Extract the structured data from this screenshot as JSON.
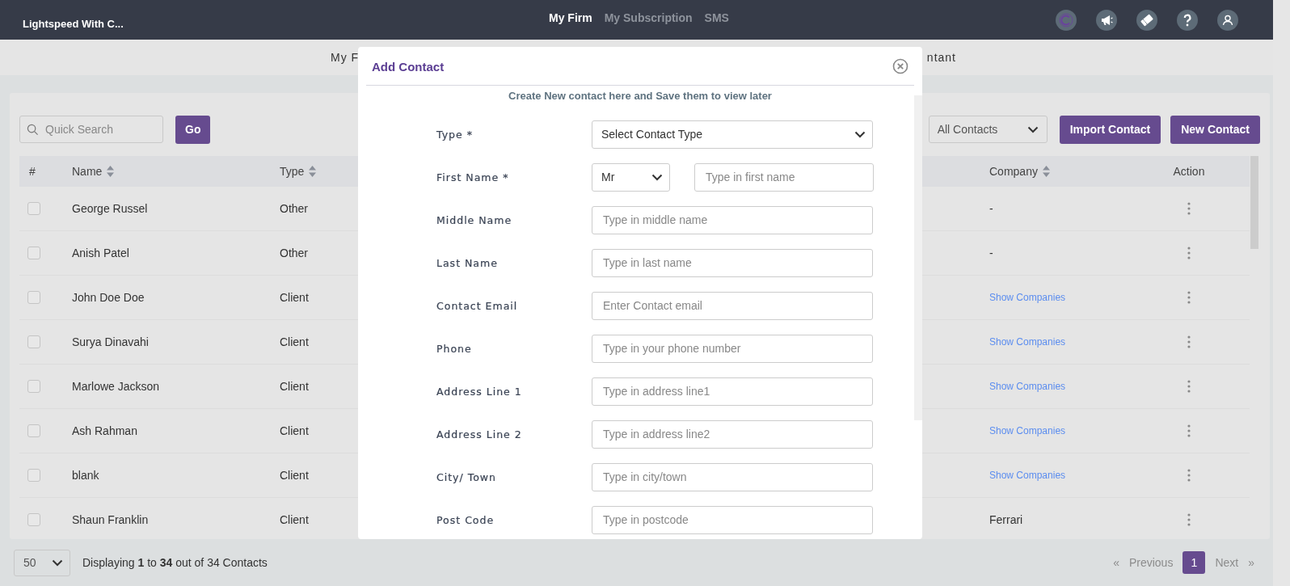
{
  "topbar": {
    "brand": "Lightspeed With C...",
    "nav": [
      {
        "label": "My Firm",
        "selected": true
      },
      {
        "label": "My Subscription",
        "selected": false
      },
      {
        "label": "SMS",
        "selected": false
      }
    ]
  },
  "subnav": {
    "items": [
      {
        "label": "My F"
      },
      {
        "label": "ntant"
      }
    ]
  },
  "toolbar": {
    "search": {
      "placeholder": "Quick Search"
    },
    "go_button": "Go",
    "filter": {
      "value": "All Contacts"
    },
    "buttons": [
      "Import Contact",
      "New Contact"
    ]
  },
  "table": {
    "columns": [
      {
        "label": "#",
        "sortable": false,
        "kind": "check"
      },
      {
        "label": "Name",
        "sortable": true,
        "kind": "name"
      },
      {
        "label": "Type",
        "sortable": true,
        "kind": "type"
      },
      {
        "label": "Company",
        "sortable": true,
        "kind": "company"
      },
      {
        "label": "Action",
        "sortable": false,
        "kind": "action"
      }
    ],
    "rows": [
      {
        "checked": false,
        "name": "George Russel",
        "type": "Other",
        "company": {
          "kind": "text",
          "text": "-"
        }
      },
      {
        "checked": false,
        "name": "Anish Patel",
        "type": "Other",
        "company": {
          "kind": "text",
          "text": "-"
        }
      },
      {
        "checked": false,
        "name": "John Doe Doe",
        "type": "Client",
        "company": {
          "kind": "link",
          "text": "Show Companies"
        }
      },
      {
        "checked": false,
        "name": "Surya Dinavahi",
        "type": "Client",
        "company": {
          "kind": "link",
          "text": "Show Companies"
        }
      },
      {
        "checked": false,
        "name": "Marlowe Jackson",
        "type": "Client",
        "company": {
          "kind": "link",
          "text": "Show Companies"
        }
      },
      {
        "checked": false,
        "name": "Ash Rahman",
        "type": "Client",
        "company": {
          "kind": "link",
          "text": "Show Companies"
        }
      },
      {
        "checked": false,
        "name": "blank",
        "type": "Client",
        "company": {
          "kind": "link",
          "text": "Show Companies"
        }
      },
      {
        "checked": false,
        "name": "Shaun Franklin",
        "type": "Client",
        "company": {
          "kind": "text",
          "text": "Ferrari"
        }
      }
    ]
  },
  "footer": {
    "page_size": "50",
    "summary": "Displaying **1** to **34** out of 34 Contacts",
    "pagination": {
      "first": {
        "label": "«",
        "disabled": true
      },
      "previous": {
        "label": "Previous",
        "disabled": true
      },
      "pages": [
        {
          "label": "1",
          "selected": true
        }
      ],
      "next": {
        "label": "Next",
        "disabled": true
      },
      "last": {
        "label": "»",
        "disabled": true
      }
    }
  },
  "modal": {
    "title": "Add Contact",
    "subtitle": "Create New contact here and Save them to view later",
    "fields": [
      {
        "kind": "select",
        "label": "Type *",
        "value": "Select Contact Type"
      },
      {
        "kind": "name",
        "label": "First Name *",
        "title": "Mr",
        "placeholder": "Type in first name"
      },
      {
        "kind": "input",
        "label": "Middle Name",
        "placeholder": "Type in middle name"
      },
      {
        "kind": "input",
        "label": "Last Name",
        "placeholder": "Type in last name"
      },
      {
        "kind": "input",
        "label": "Contact Email",
        "placeholder": "Enter Contact email"
      },
      {
        "kind": "input",
        "label": "Phone",
        "placeholder": "Type in your phone number"
      },
      {
        "kind": "input",
        "label": "Address Line 1",
        "placeholder": "Type in address line1"
      },
      {
        "kind": "input",
        "label": "Address Line 2",
        "placeholder": "Type in address line2"
      },
      {
        "kind": "input",
        "label": "City/ Town",
        "placeholder": "Type in city/town"
      },
      {
        "kind": "input",
        "label": "Post Code",
        "placeholder": "Type in postcode"
      }
    ]
  }
}
